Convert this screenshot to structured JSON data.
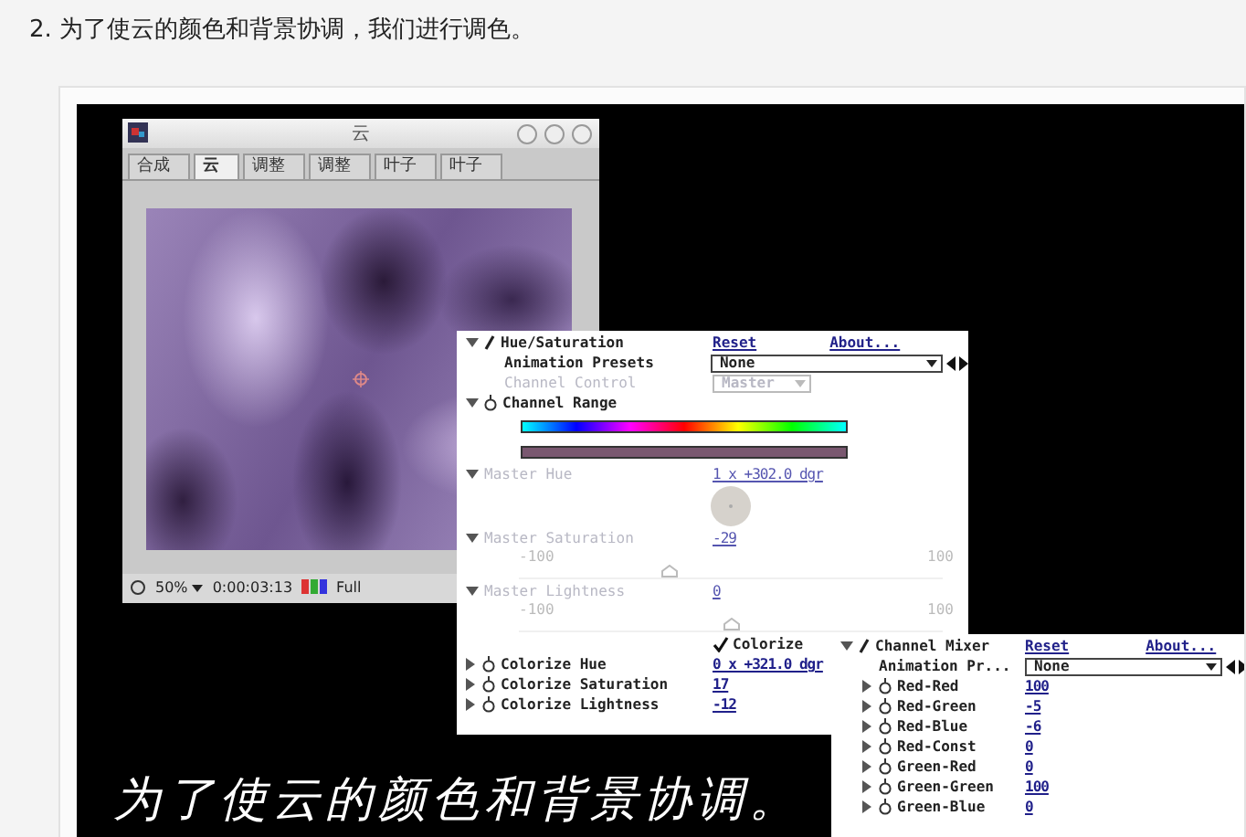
{
  "heading": "2. 为了使云的颜色和背景协调，我们进行调色。",
  "comp_window": {
    "title": "云",
    "tabs": [
      {
        "label": "合成",
        "selected": false
      },
      {
        "label": "云",
        "selected": true
      },
      {
        "label": "调整",
        "selected": false
      },
      {
        "label": "调整",
        "selected": false
      },
      {
        "label": "叶子",
        "selected": false
      },
      {
        "label": "叶子",
        "selected": false
      }
    ],
    "zoom": "50%",
    "timecode": "0:00:03:13",
    "resolution": "Full"
  },
  "hue_saturation": {
    "title": "Hue/Saturation",
    "reset": "Reset",
    "about": "About...",
    "animation_presets": {
      "label": "Animation Presets",
      "value": "None"
    },
    "channel_control": {
      "label": "Channel Control",
      "value": "Master",
      "disabled": true
    },
    "channel_range": {
      "label": "Channel Range"
    },
    "master_hue": {
      "label": "Master Hue",
      "value": "1 x +302.0 dgr",
      "disabled": true
    },
    "sliders": [
      {
        "label": "Master Saturation",
        "value": "-29",
        "min": "-100",
        "max": "100",
        "level": 0.355,
        "disabled": true
      },
      {
        "label": "Master Lightness",
        "value": "0",
        "min": "-100",
        "max": "100",
        "level": 0.5,
        "disabled": true
      }
    ],
    "colorize": {
      "label": "Colorize",
      "checked": true
    },
    "colorize_params": [
      {
        "label": "Colorize Hue",
        "value": "0 x +321.0 dgr"
      },
      {
        "label": "Colorize Saturation",
        "value": "17"
      },
      {
        "label": "Colorize Lightness",
        "value": "-12"
      }
    ]
  },
  "channel_mixer": {
    "title": "Channel Mixer",
    "reset": "Reset",
    "about": "About...",
    "animation_presets": {
      "label": "Animation Pr...",
      "value": "None"
    },
    "rows": [
      {
        "label": "Red-Red",
        "value": "100"
      },
      {
        "label": "Red-Green",
        "value": "-5"
      },
      {
        "label": "Red-Blue",
        "value": "-6"
      },
      {
        "label": "Red-Const",
        "value": "0"
      },
      {
        "label": "Green-Red",
        "value": "0"
      },
      {
        "label": "Green-Green",
        "value": "100"
      },
      {
        "label": "Green-Blue",
        "value": "0"
      }
    ]
  },
  "caption": "为了使云的颜色和背景协调。"
}
